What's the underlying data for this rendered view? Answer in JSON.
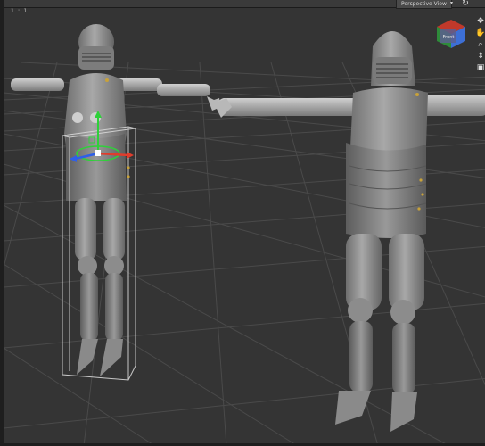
{
  "viewport": {
    "camera_label": "Perspective View",
    "aspect_label": "1 : 1",
    "dropdown_icon": "triangle-down-icon",
    "refresh_icon": "refresh-icon"
  },
  "nav_cube": {
    "face_label": "Front",
    "colors": {
      "top": "#c0392b",
      "left": "#2e8b3a",
      "right": "#3d6fd6",
      "front": "#5a5f8f"
    }
  },
  "nav_tools": [
    {
      "name": "orbit-icon",
      "glyph": "✥"
    },
    {
      "name": "pan-icon",
      "glyph": "✋"
    },
    {
      "name": "zoom-icon",
      "glyph": "🔍"
    },
    {
      "name": "dolly-icon",
      "glyph": "⇕"
    },
    {
      "name": "frame-icon",
      "glyph": "▣"
    }
  ],
  "gizmo": {
    "x_axis_color": "#e03c2c",
    "y_axis_color": "#2fd13a",
    "z_axis_color": "#2f5fe8"
  }
}
